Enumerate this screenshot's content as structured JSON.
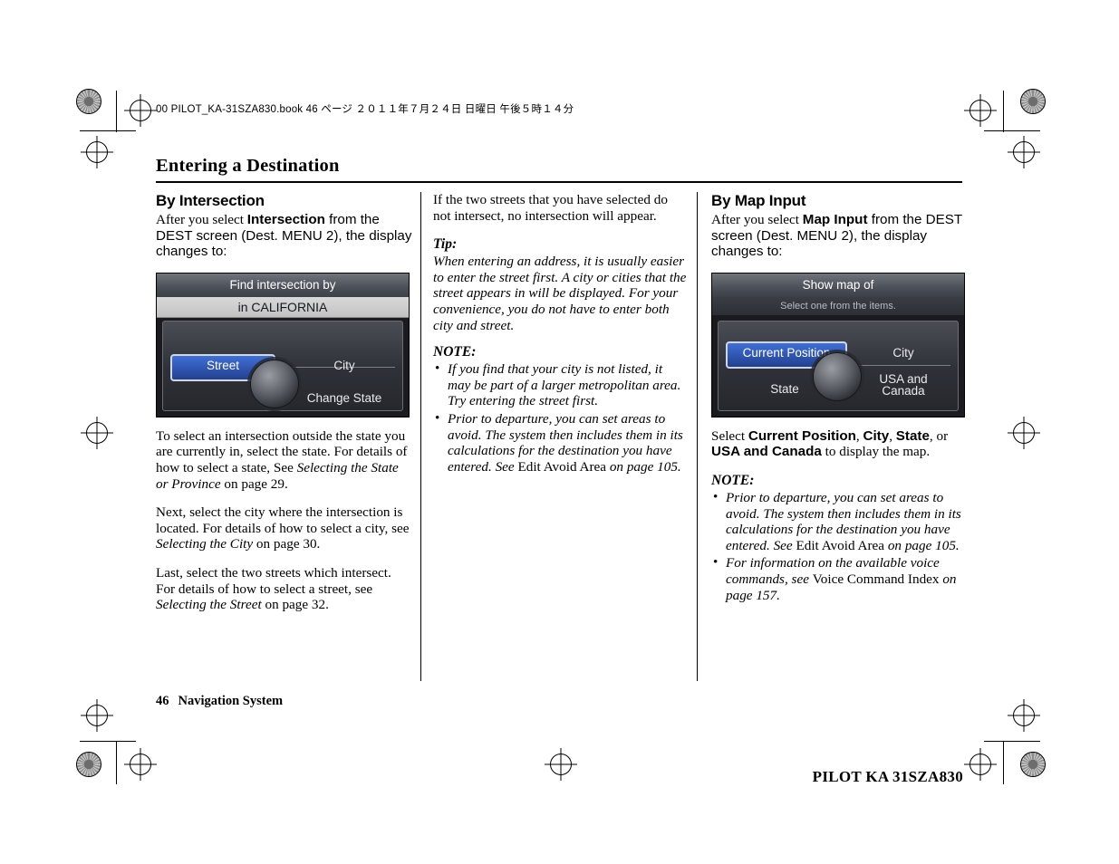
{
  "slug": "00 PILOT_KA-31SZA830.book   46 ページ   ２０１１年７月２４日   日曜日   午後５時１４分",
  "page_title": "Entering a Destination",
  "footer": {
    "page_number": "46",
    "section": "Navigation System"
  },
  "corner_code": "PILOT KA  31SZA830",
  "col1": {
    "heading": "By Intersection",
    "intro_1": "After you select ",
    "intro_bold": "Intersection",
    "intro_2": " from the DEST screen (Dest. MENU 2), the display changes to:",
    "screen": {
      "title": "Find intersection by",
      "state_line": "in CALIFORNIA",
      "btn_street": "Street",
      "btn_city": "City",
      "btn_change_state": "Change State"
    },
    "p2_a": "To select an intersection outside the state you are currently in, select the state. For details of how to select a state, See ",
    "p2_italic": "Selecting the State or Province",
    "p2_b": " on page 29.",
    "p3_a": "Next, select the city where the intersection is located. For details of how to select a city, see ",
    "p3_italic": "Selecting the City",
    "p3_b": " on page 30.",
    "p4_a": "Last, select the two streets which intersect. For details of how to select a street, see ",
    "p4_italic": "Selecting the Street",
    "p4_b": " on page 32."
  },
  "col2": {
    "p1": "If the two streets that you have selected do not intersect, no intersection will appear.",
    "tip_label": "Tip:",
    "tip_text": "When entering an address, it is usually easier to enter the street first. A city or cities that the street appears in will be displayed. For your convenience, you do not have to enter both city and street.",
    "note_label": "NOTE:",
    "notes": [
      {
        "text": "If you find that your city is not listed, it may be part of a larger metropolitan area. Try entering the street first."
      },
      {
        "text": "Prior to departure, you can set areas to avoid. The system then includes them in its calculations for the destination you have entered. See ",
        "roman": "Edit Avoid Area",
        "tail": " on page 105."
      }
    ]
  },
  "col3": {
    "heading": "By Map Input",
    "intro_1": "After you select ",
    "intro_bold": "Map Input",
    "intro_2": " from the DEST screen (Dest. MENU 2), the display changes to:",
    "screen": {
      "title": "Show map of",
      "subtitle": "Select one from the items.",
      "btn_current_position": "Current Position",
      "btn_city": "City",
      "btn_state": "State",
      "btn_usa_canada_line1": "USA and",
      "btn_usa_canada_line2": "Canada"
    },
    "select_a": "Select ",
    "select_b1": "Current Position",
    "select_c": ", ",
    "select_b2": "City",
    "select_d": ", ",
    "select_b3": "State",
    "select_e": ", or ",
    "select_b4": "USA and Canada",
    "select_f": " to display the map.",
    "note_label": "NOTE:",
    "notes": [
      {
        "text": "Prior to departure, you can set areas to avoid. The system then includes them in its calculations for the destination you have entered. See ",
        "roman": "Edit Avoid Area",
        "tail": " on page 105."
      },
      {
        "text": "For information on the available voice commands, see ",
        "roman": "Voice Command Index",
        "tail": " on page 157."
      }
    ]
  }
}
